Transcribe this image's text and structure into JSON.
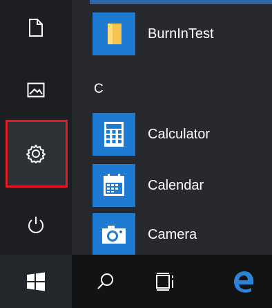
{
  "rail": {
    "items": [
      {
        "icon": "document-icon"
      },
      {
        "icon": "pictures-icon"
      },
      {
        "icon": "settings-gear-icon"
      },
      {
        "icon": "power-icon"
      }
    ]
  },
  "app_list": {
    "apps": [
      {
        "label": "BurnInTest",
        "icon": "folder-icon",
        "tile_color": "#1f7ad1"
      },
      {
        "label": "Calculator",
        "icon": "calculator-icon",
        "tile_color": "#1f7ad1"
      },
      {
        "label": "Calendar",
        "icon": "calendar-icon",
        "tile_color": "#1f7ad1"
      },
      {
        "label": "Camera",
        "icon": "camera-icon",
        "tile_color": "#1f7ad1"
      }
    ],
    "section_letter": "C"
  },
  "taskbar": {
    "items": [
      {
        "icon": "windows-start-icon"
      },
      {
        "icon": "search-icon"
      },
      {
        "icon": "task-view-icon"
      },
      {
        "icon": "edge-browser-icon"
      }
    ]
  },
  "colors": {
    "highlight": "#e51b23",
    "tile": "#1f7ad1",
    "edge": "#2b84d7"
  }
}
